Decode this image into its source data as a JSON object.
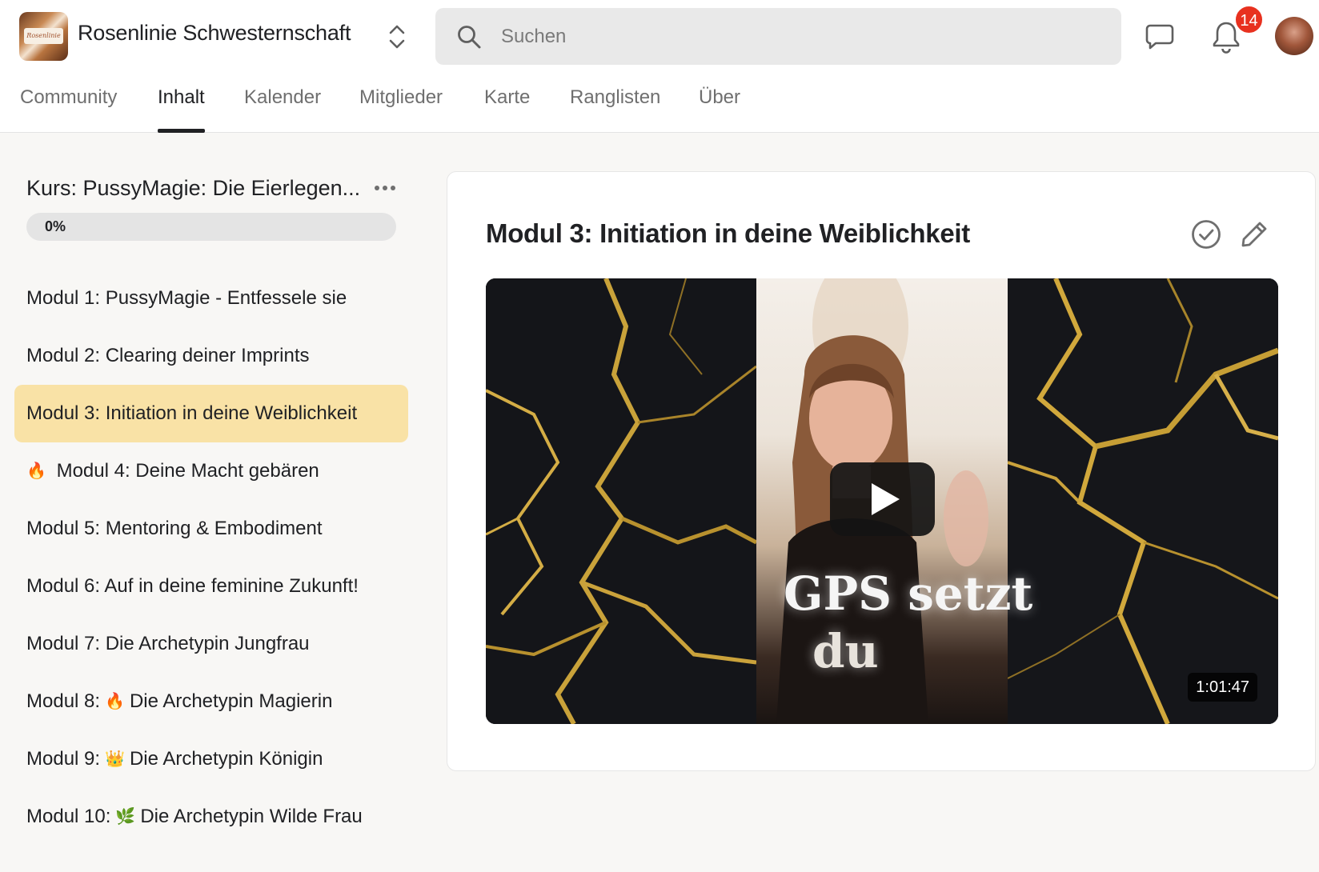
{
  "header": {
    "group_name": "Rosenlinie Schwesternschaft",
    "logo_text": "Rosenlinie",
    "search_placeholder": "Suchen",
    "notification_count": "14",
    "icons": {
      "switcher": "chevron-up-down-icon",
      "search": "search-icon",
      "chat": "chat-bubble-icon",
      "notifications": "bell-icon"
    }
  },
  "tabs": [
    {
      "label": "Community",
      "active": false
    },
    {
      "label": "Inhalt",
      "active": true
    },
    {
      "label": "Kalender",
      "active": false
    },
    {
      "label": "Mitglieder",
      "active": false
    },
    {
      "label": "Karte",
      "active": false
    },
    {
      "label": "Ranglisten",
      "active": false
    },
    {
      "label": "Über",
      "active": false
    }
  ],
  "sidebar": {
    "course_title": "Kurs: PussyMagie: Die Eierlegen...",
    "progress_label": "0%",
    "progress_value": 0,
    "modules": [
      {
        "prefix": "",
        "emoji": "",
        "label": "Modul 1: PussyMagie - Entfessele sie",
        "active": false
      },
      {
        "prefix": "",
        "emoji": "",
        "label": "Modul 2: Clearing deiner Imprints",
        "active": false
      },
      {
        "prefix": "",
        "emoji": "",
        "label": "Modul 3: Initiation in deine Weiblichkeit",
        "active": true
      },
      {
        "prefix": "",
        "emoji": "🔥",
        "label": "Modul 4: Deine Macht gebären",
        "active": false
      },
      {
        "prefix": "",
        "emoji": "",
        "label": "Modul 5: Mentoring & Embodiment",
        "active": false
      },
      {
        "prefix": "",
        "emoji": "",
        "label": "Modul 6: Auf in deine feminine Zukunft!",
        "active": false
      },
      {
        "prefix": "",
        "emoji": "",
        "label": "Modul 7: Die Archetypin Jungfrau",
        "active": false
      },
      {
        "prefix": "Modul 8:",
        "emoji": "🔥",
        "label": "Die Archetypin Magierin",
        "active": false
      },
      {
        "prefix": "Modul 9:",
        "emoji": "👑",
        "label": "Die Archetypin Königin",
        "active": false
      },
      {
        "prefix": "Modul 10:",
        "emoji": "🌿",
        "label": "Die Archetypin Wilde Frau",
        "active": false
      }
    ]
  },
  "content": {
    "title": "Modul 3: Initiation in deine Weiblichkeit",
    "video": {
      "overlay_line1": "GPS setzt",
      "overlay_line2": "du",
      "duration": "1:01:47"
    }
  },
  "colors": {
    "accent_active_module": "#f9e2a6",
    "notification_badge": "#e8311f",
    "text_primary": "#202124",
    "text_secondary": "#6f6f6f"
  }
}
